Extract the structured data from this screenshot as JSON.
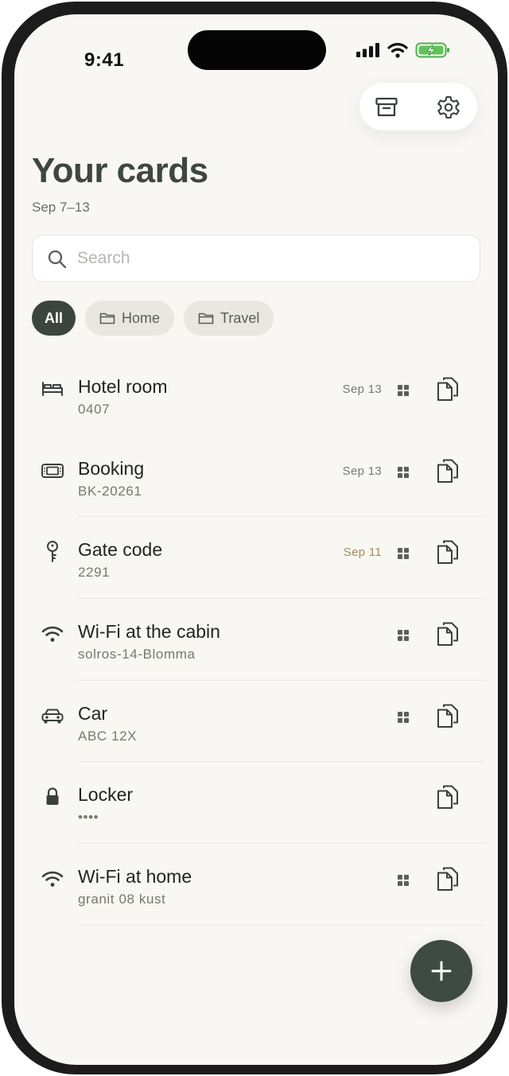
{
  "status_bar": {
    "time": "9:41"
  },
  "header": {
    "title": "Your cards",
    "subtitle": "Sep 7–13"
  },
  "search": {
    "placeholder": "Search",
    "value": ""
  },
  "filters": [
    {
      "label": "All",
      "active": true
    },
    {
      "label": "Home",
      "active": false
    },
    {
      "label": "Travel",
      "active": false
    }
  ],
  "cards": [
    {
      "icon": "bed-icon",
      "title": "Hotel room",
      "value": "0407",
      "date": "Sep 13",
      "date_soon": false,
      "has_grid": true
    },
    {
      "icon": "ticket-icon",
      "title": "Booking",
      "value": "BK-20261",
      "date": "Sep 13",
      "date_soon": false,
      "has_grid": true
    },
    {
      "icon": "key-icon",
      "title": "Gate code",
      "value": "2291",
      "date": "Sep 11",
      "date_soon": true,
      "has_grid": true
    },
    {
      "icon": "wifi-icon",
      "title": "Wi-Fi at the cabin",
      "value": "solros-14-Blomma",
      "date": "",
      "date_soon": false,
      "has_grid": true
    },
    {
      "icon": "car-icon",
      "title": "Car",
      "value": "ABC 12X",
      "date": "",
      "date_soon": false,
      "has_grid": true
    },
    {
      "icon": "lock-icon",
      "title": "Locker",
      "value": "••••",
      "date": "",
      "date_soon": false,
      "has_grid": false
    },
    {
      "icon": "wifi-icon",
      "title": "Wi-Fi at home",
      "value": "granit 08 kust",
      "date": "",
      "date_soon": false,
      "has_grid": true
    }
  ],
  "colors": {
    "accent": "#3b453d",
    "background": "#f8f7f3",
    "soon_date": "#a58d5d"
  }
}
